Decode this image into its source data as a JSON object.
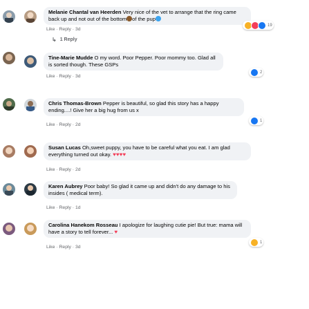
{
  "comments": [
    {
      "author": "Melanie Chantal van Heerden",
      "text_a": "Very nice of the vet to arrange that the ring came back up and not out of the bottom",
      "text_b": "of the pup",
      "actions": {
        "like": "Like",
        "sep1": "·",
        "reply": "Reply",
        "sep2": "·",
        "time": "3d"
      },
      "reaction_count": "19",
      "replies_label": "1 Reply"
    },
    {
      "author": "Tine-Marie Mudde",
      "text": "O my word. Poor Pepper. Poor mommy too. Glad all is sorted though. These GSPs",
      "actions": {
        "like": "Like",
        "sep1": "·",
        "reply": "Reply",
        "sep2": "·",
        "time": "3d"
      },
      "reaction_count": "2"
    },
    {
      "author": "Chris Thomas-Brown",
      "text": "Pepper is beautiful, so glad this story has a happy ending....! Give her a big hug from us x",
      "actions": {
        "like": "Like",
        "sep1": "·",
        "reply": "Reply",
        "sep2": "·",
        "time": "2d"
      },
      "reaction_count": "1"
    },
    {
      "author": "Susan Lucas",
      "text": "Oh,sweet puppy, you have to be careful what you eat. I am glad everything turned out okay.",
      "actions": {
        "like": "Like",
        "sep1": "·",
        "reply": "Reply",
        "sep2": "·",
        "time": "2d"
      }
    },
    {
      "author": "Karen Aubrey",
      "text": "Poor baby! So glad it came up and didn't do any damage to his insides ( medical term).",
      "actions": {
        "like": "Like",
        "sep1": "·",
        "reply": "Reply",
        "sep2": "·",
        "time": "1d"
      }
    },
    {
      "author": "Carolina Hanekom Rosseau",
      "text": "I apologize for laughing cutie pie! But true: mama will have a story to tell forever...",
      "actions": {
        "like": "Like",
        "sep1": "·",
        "reply": "Reply",
        "sep2": "·",
        "time": "3d"
      },
      "reaction_count": "1"
    }
  ],
  "colors": {
    "like": "#1877f2",
    "love": "#f33e58",
    "haha": "#f7b125",
    "bubble": "#f0f2f5",
    "meta": "#65676b"
  },
  "icons": [
    "avatar-photo",
    "reply-arrow-icon",
    "heart-emoji-icon",
    "poop-emoji-icon",
    "like-reaction-icon",
    "love-reaction-icon",
    "haha-reaction-icon"
  ]
}
